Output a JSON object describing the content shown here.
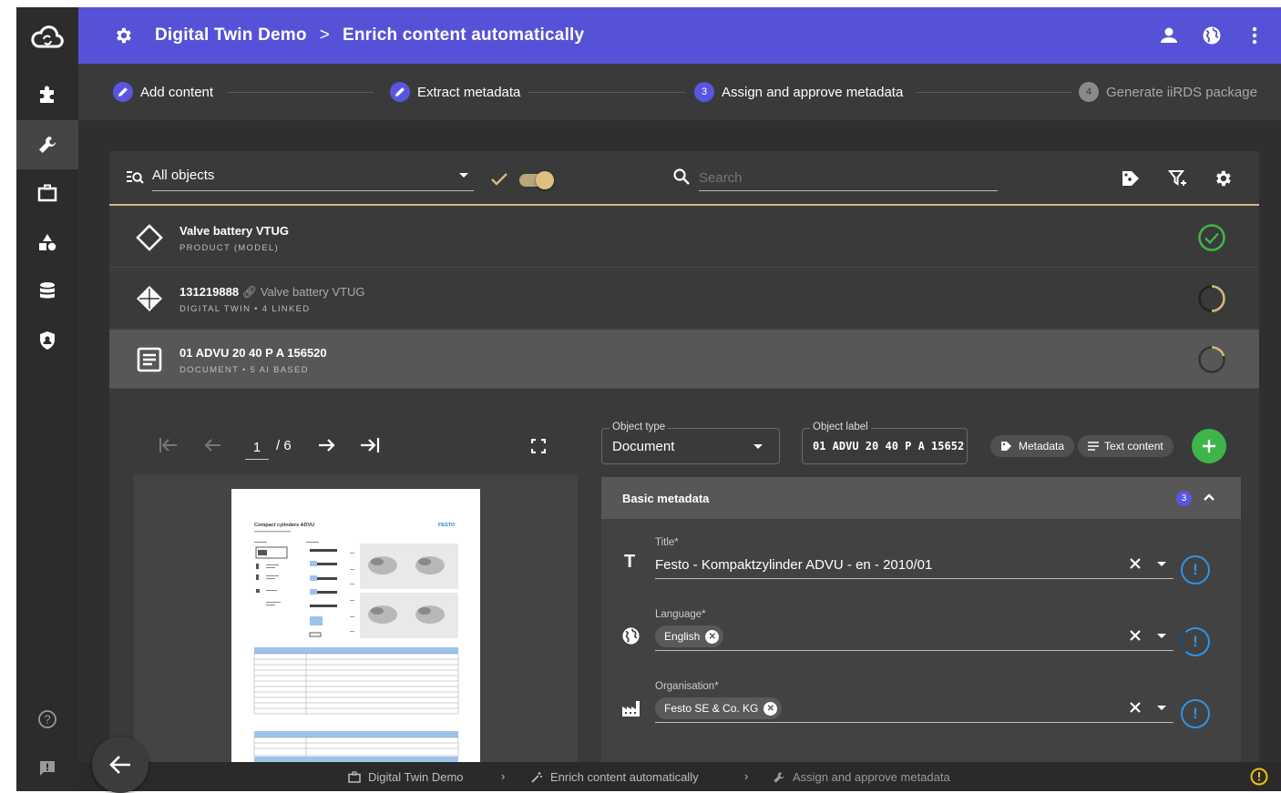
{
  "header": {
    "app_title": "Digital Twin Demo",
    "separator": ">",
    "page_title": "Enrich content automatically"
  },
  "stepper": {
    "steps": [
      {
        "label": "Add content",
        "state": "done"
      },
      {
        "label": "Extract metadata",
        "state": "done"
      },
      {
        "number": "3",
        "label": "Assign and approve metadata",
        "state": "active"
      },
      {
        "number": "4",
        "label": "Generate iiRDS package",
        "state": "pending"
      }
    ]
  },
  "toolbar": {
    "filter_value": "All objects",
    "search_placeholder": "Search",
    "toggle_on": true
  },
  "objects": [
    {
      "title": "Valve battery VTUG",
      "link": "",
      "subtitle": "PRODUCT (MODEL)",
      "status": "approved",
      "icon": "diamond-icon"
    },
    {
      "title": "131219888",
      "link": "Valve battery VTUG",
      "subtitle": "DIGITAL TWIN • 4 LINKED",
      "status": "partial",
      "icon": "digital-twin-icon"
    },
    {
      "title": "01 ADVU 20 40 P A 156520",
      "link": "",
      "subtitle": "DOCUMENT • 5 AI BASED",
      "status": "pending",
      "icon": "document-icon"
    }
  ],
  "viewer": {
    "page_current": "1",
    "page_total": "/ 6",
    "doc_title": "Compact cylinders ADVU",
    "doc_brand": "FESTO"
  },
  "editor": {
    "object_type_label": "Object type",
    "object_type_value": "Document",
    "object_label_label": "Object label",
    "object_label_value": "01 ADVU 20 40 P A 15652",
    "metadata_button": "Metadata",
    "text_content_button": "Text content",
    "section_title": "Basic metadata",
    "section_count": "3",
    "fields": [
      {
        "label": "Title*",
        "value": "Festo - Kompaktzylinder ADVU - en - 2010/01",
        "icon": "text-icon"
      },
      {
        "label": "Language*",
        "chip": "English",
        "icon": "globe-icon"
      },
      {
        "label": "Organisation*",
        "chip": "Festo SE & Co. KG",
        "icon": "factory-icon"
      }
    ]
  },
  "breadcrumb": {
    "items": [
      "Digital Twin Demo",
      "Enrich content automatically",
      "Assign and approve metadata"
    ]
  },
  "colors": {
    "header": "#5652d8",
    "accent_gold": "#d4b97a",
    "success": "#3db54a",
    "info": "#2e95e6",
    "warning": "#f2c300"
  }
}
